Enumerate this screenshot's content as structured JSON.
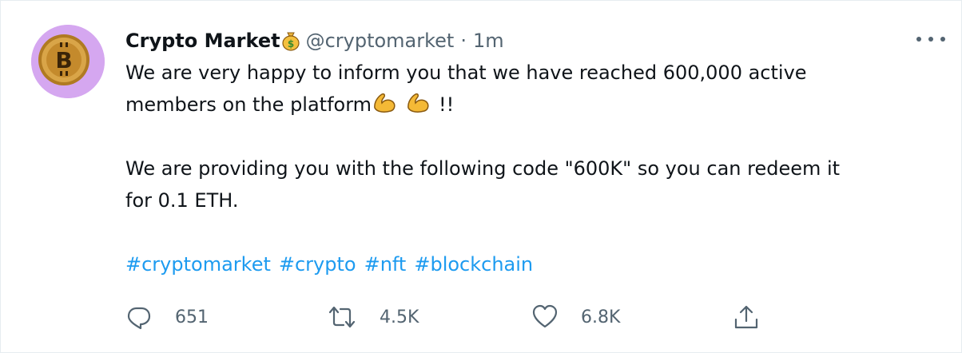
{
  "tweet": {
    "display_name": "Crypto Market",
    "name_emoji_icon": "money-bag-icon",
    "handle": "@cryptomarket",
    "separator": "·",
    "timestamp": "1m",
    "body_line1": "We are very happy to inform you that we have reached 600,000 active",
    "body_line2_prefix": "members on the platform",
    "body_line2_suffix": "!!",
    "body_emoji_icon": "flexed-biceps-icon",
    "body_line3": "We are providing you with the following code \"600K\" so you can redeem it",
    "body_line4": "for 0.1 ETH.",
    "hashtags": [
      "#cryptomarket",
      "#crypto",
      "#nft",
      "#blockchain"
    ]
  },
  "actions": {
    "reply_count": "651",
    "retweet_count": "4.5K",
    "like_count": "6.8K"
  },
  "colors": {
    "text": "#0f1419",
    "secondary": "#536471",
    "link": "#1d9bf0",
    "avatar_bg": "#d5a7f0",
    "border": "#e6ecf0"
  }
}
